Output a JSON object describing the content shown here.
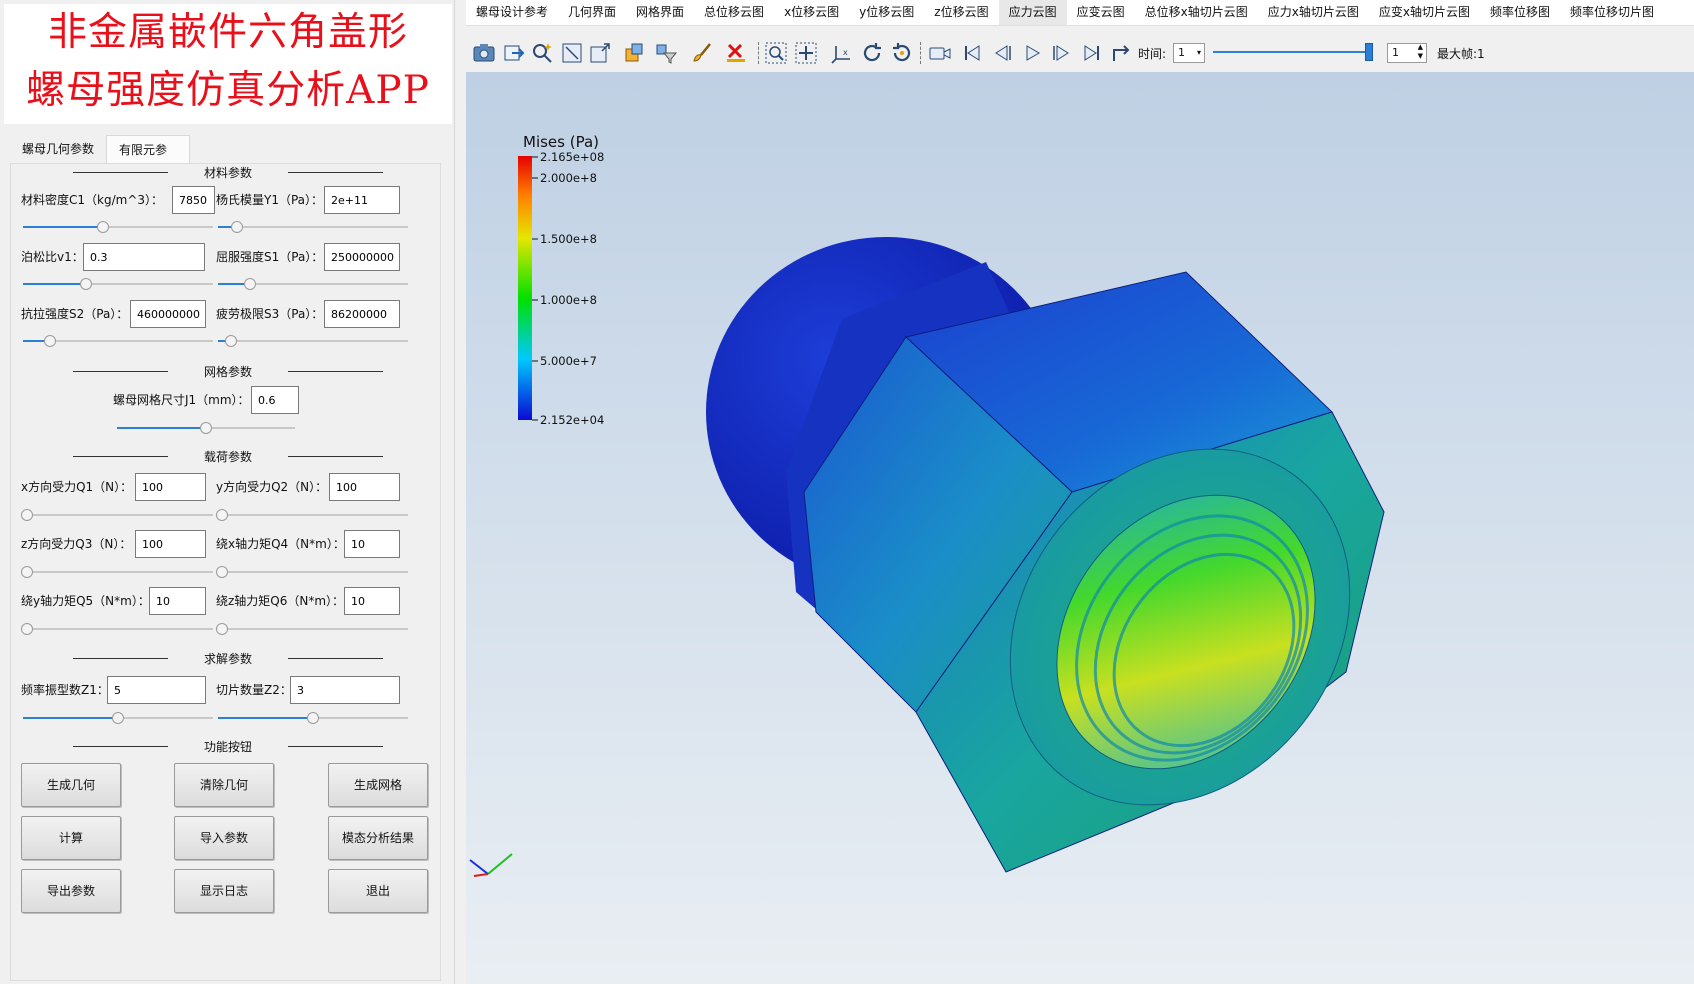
{
  "app": {
    "title_line1": "非金属嵌件六角盖形",
    "title_line2": "螺母强度仿真分析APP"
  },
  "tabs": [
    {
      "label": "螺母几何参数",
      "active": false
    },
    {
      "label": "有限元参数",
      "active": true
    }
  ],
  "sections": {
    "material": "材料参数",
    "mesh": "网格参数",
    "load": "载荷参数",
    "solve": "求解参数",
    "functions": "功能按钮"
  },
  "fields": {
    "density": {
      "label": "材料密度C1（kg/m^3）：",
      "value": "7850",
      "slider": 0.42
    },
    "youngs": {
      "label": "杨氏模量Y1（Pa）：",
      "value": "2e+11",
      "slider": 0.1
    },
    "poisson": {
      "label": "泊松比v1：",
      "value": "0.3",
      "slider": 0.33
    },
    "yield": {
      "label": "屈服强度S1（Pa）：",
      "value": "250000000",
      "slider": 0.17
    },
    "tensile": {
      "label": "抗拉强度S2（Pa）：",
      "value": "460000000",
      "slider": 0.14
    },
    "fatigue": {
      "label": "疲劳极限S3（Pa）：",
      "value": "86200000",
      "slider": 0.07
    },
    "mesh_size": {
      "label": "螺母网格尺寸J1（mm）：",
      "value": "0.6",
      "slider": 0.5
    },
    "fx": {
      "label": "x方向受力Q1（N）：",
      "value": "100",
      "slider": 0.02
    },
    "fy": {
      "label": "y方向受力Q2（N）：",
      "value": "100",
      "slider": 0.02
    },
    "fz": {
      "label": "z方向受力Q3（N）：",
      "value": "100",
      "slider": 0.02
    },
    "mx": {
      "label": "绕x轴力矩Q4（N*m）：",
      "value": "10",
      "slider": 0.02
    },
    "my": {
      "label": "绕y轴力矩Q5（N*m）：",
      "value": "10",
      "slider": 0.02
    },
    "mz": {
      "label": "绕z轴力矩Q6（N*m）：",
      "value": "10",
      "slider": 0.02
    },
    "modes": {
      "label": "频率振型数Z1：",
      "value": "5",
      "slider": 0.5
    },
    "slices": {
      "label": "切片数量Z2：",
      "value": "3",
      "slider": 0.5
    }
  },
  "buttons": {
    "gen_geo": "生成几何",
    "clear_geo": "清除几何",
    "gen_mesh": "生成网格",
    "compute": "计算",
    "import_params": "导入参数",
    "modal_results": "模态分析结果",
    "export_params": "导出参数",
    "show_log": "显示日志",
    "exit": "退出"
  },
  "menu": [
    "螺母设计参考",
    "几何界面",
    "网格界面",
    "总位移云图",
    "x位移云图",
    "y位移云图",
    "z位移云图",
    "应力云图",
    "应变云图",
    "总位移x轴切片云图",
    "应力x轴切片云图",
    "应变x轴切片云图",
    "频率位移图",
    "频率位移切片图"
  ],
  "menu_active_index": 7,
  "toolbar": {
    "time_label": "时间:",
    "time_value": "1",
    "frame_value": "1",
    "max_frame_label": "最大帧:1",
    "time_slider": 0.98
  },
  "legend": {
    "title": "Mises (Pa)",
    "ticks": [
      "2.165e+08",
      "2.000e+8",
      "1.500e+8",
      "1.000e+8",
      "5.000e+7",
      "2.152e+04"
    ],
    "colors": [
      "#0a0ad2",
      "#00c8ff",
      "#00e000",
      "#e6e600",
      "#ff8000",
      "#e60000"
    ]
  },
  "colors": {
    "title_red": "#e8101a",
    "slider_blue": "#2b7fd6"
  }
}
